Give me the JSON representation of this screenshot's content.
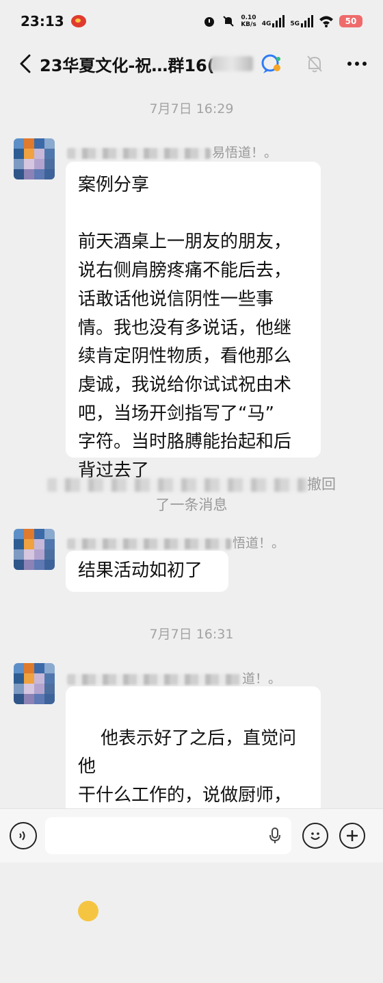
{
  "status_bar": {
    "time": "23:13",
    "net_speed": "0.10\nKB/s",
    "net1": "4G",
    "net2": "5G",
    "battery": "50"
  },
  "header": {
    "back_icon": "chevron-left-icon",
    "title": "23华夏文化-祝…群16(",
    "ai_icon": "chat-bubble-icon",
    "mute_icon": "bell-off-icon",
    "more_icon": "more-icon"
  },
  "messages": {
    "time1": "7月7日 16:29",
    "sender1_suffix": "易悟道！。",
    "bubble1": "案例分享\n\n前天酒桌上一朋友的朋友，\n说右侧肩膀疼痛不能后去，\n话敢话他说信阴性一些事\n情。我也没有多说话，他继\n续肯定阴性物质，看他那么\n虔诚，我说给你试试祝由术\n吧，当场开剑指写了“马”\n字符。当时胳膊能抬起和后\n背过去了",
    "recall_suffix": "撤回",
    "recall_line2": "了一条消息",
    "sender2_suffix": "悟道！。",
    "bubble2": "结果活动如初了",
    "time2": "7月7日 16:31",
    "sender3_suffix": "道！。",
    "bubble3": "他表示好了之后，直觉问他\n干什么工作的，说做厨师，\n问他是否杀鱼多，回“是”，\n让当场忏悔说对不起“鱼”"
  },
  "input_bar": {
    "voice_icon": "voice-icon",
    "mic_icon": "mic-icon",
    "emoji_icon": "emoji-icon",
    "plus_icon": "plus-icon",
    "placeholder": ""
  }
}
